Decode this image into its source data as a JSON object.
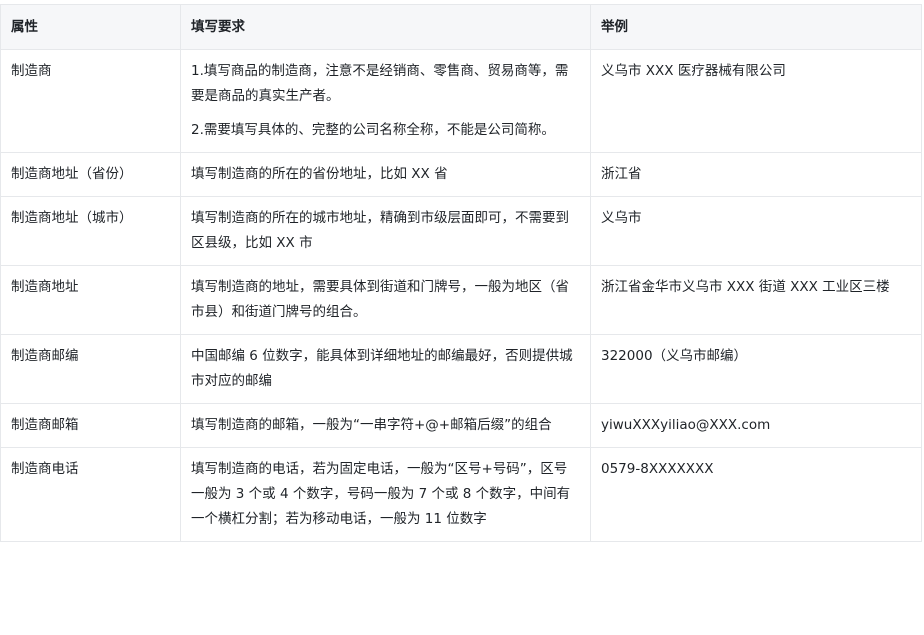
{
  "table": {
    "headers": [
      "属性",
      "填写要求",
      "举例"
    ],
    "rows": [
      {
        "attr": "制造商",
        "req": [
          "1.填写商品的制造商，注意不是经销商、零售商、贸易商等，需要是商品的真实生产者。",
          "2.需要填写具体的、完整的公司名称全称，不能是公司简称。"
        ],
        "example": "义乌市 XXX 医疗器械有限公司"
      },
      {
        "attr": "制造商地址（省份）",
        "req": [
          "填写制造商的所在的省份地址，比如 XX 省"
        ],
        "example": "浙江省"
      },
      {
        "attr": "制造商地址（城市）",
        "req": [
          "填写制造商的所在的城市地址，精确到市级层面即可，不需要到区县级，比如 XX 市"
        ],
        "example": "义乌市"
      },
      {
        "attr": "制造商地址",
        "req": [
          "填写制造商的地址，需要具体到街道和门牌号，一般为地区（省市县）和街道门牌号的组合。"
        ],
        "example": "浙江省金华市义乌市 XXX 街道 XXX 工业区三楼"
      },
      {
        "attr": "制造商邮编",
        "req": [
          "中国邮编 6 位数字，能具体到详细地址的邮编最好，否则提供城市对应的邮编"
        ],
        "example": "322000（义乌市邮编）"
      },
      {
        "attr": "制造商邮箱",
        "req": [
          "填写制造商的邮箱，一般为“一串字符+@+邮箱后缀”的组合"
        ],
        "example": "yiwuXXXyiliao@XXX.com"
      },
      {
        "attr": "制造商电话",
        "req": [
          "填写制造商的电话，若为固定电话，一般为“区号+号码”，区号一般为 3 个或 4 个数字，号码一般为 7 个或 8 个数字，中间有一个横杠分割；若为移动电话，一般为 11 位数字"
        ],
        "example": "0579-8XXXXXXX"
      }
    ]
  }
}
